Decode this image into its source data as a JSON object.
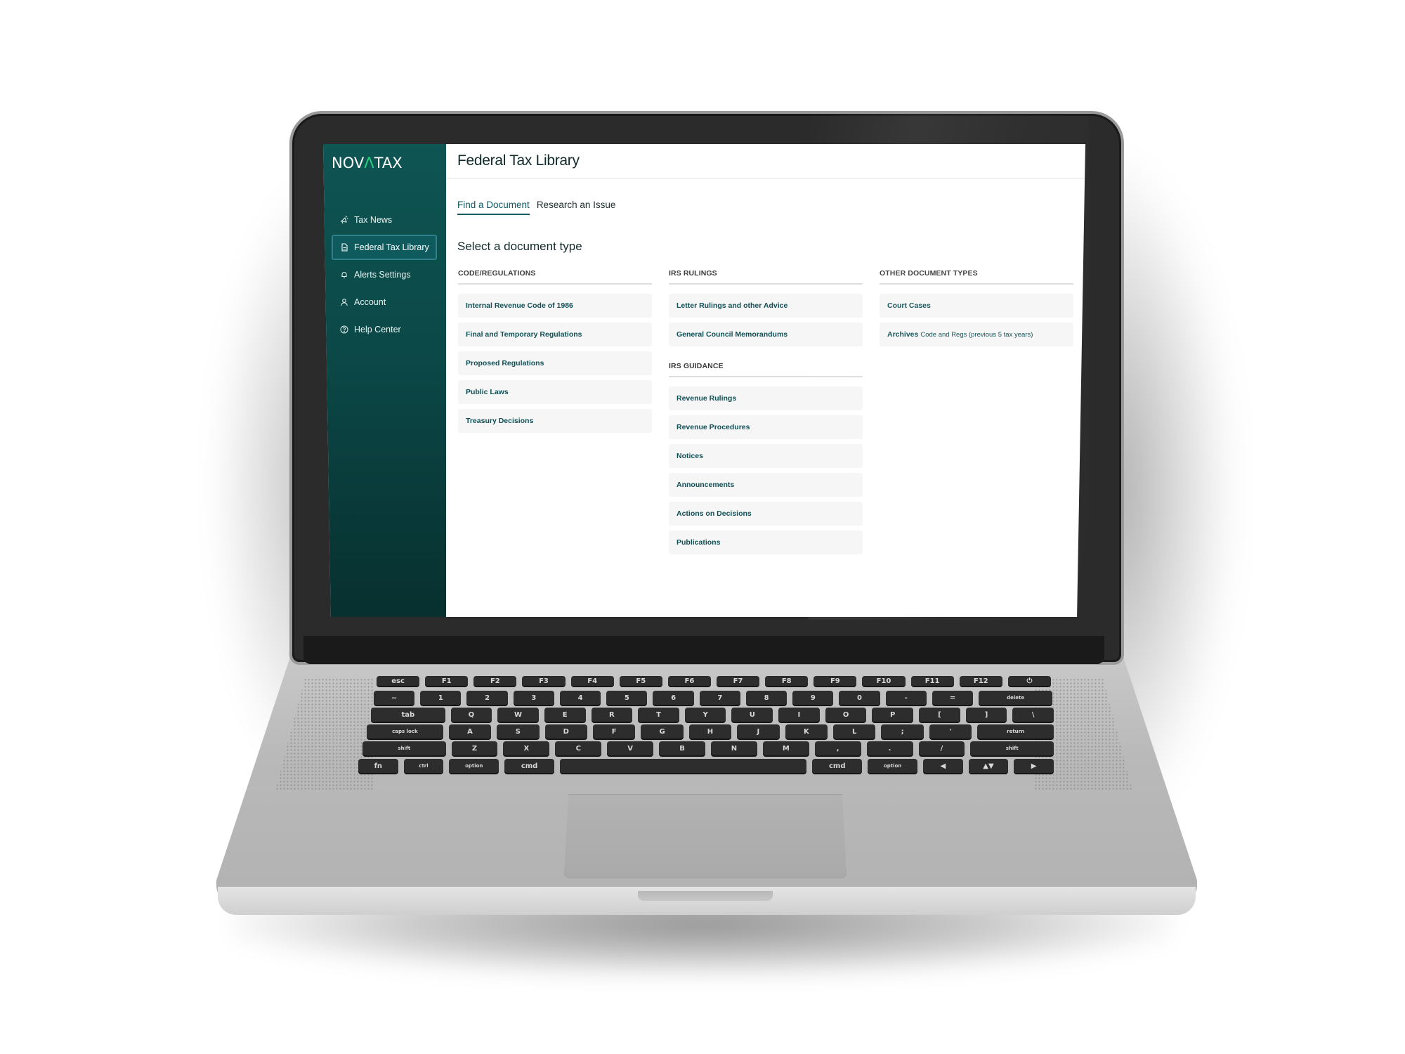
{
  "brand": {
    "logo_prefix": "NOV",
    "logo_accent": "Λ",
    "logo_suffix": "TAX",
    "accent_color": "#2ad17e",
    "primary_color": "#0f5a62"
  },
  "sidebar": {
    "items": [
      {
        "label": "Tax News",
        "icon": "megaphone-icon",
        "active": false
      },
      {
        "label": "Federal Tax Library",
        "icon": "document-icon",
        "active": true
      },
      {
        "label": "Alerts Settings",
        "icon": "bell-icon",
        "active": false
      },
      {
        "label": "Account",
        "icon": "user-icon",
        "active": false
      },
      {
        "label": "Help Center",
        "icon": "help-circle-icon",
        "active": false
      }
    ]
  },
  "header": {
    "title": "Federal Tax Library"
  },
  "tabs": [
    {
      "label": "Find a Document",
      "active": true
    },
    {
      "label": "Research an Issue",
      "active": false
    }
  ],
  "main": {
    "section_title": "Select a document type",
    "columns": [
      {
        "groups": [
          {
            "header": "CODE/REGULATIONS",
            "items": [
              {
                "label": "Internal Revenue Code of 1986"
              },
              {
                "label": "Final and Temporary Regulations"
              },
              {
                "label": "Proposed Regulations"
              },
              {
                "label": "Public Laws"
              },
              {
                "label": "Treasury Decisions"
              }
            ]
          }
        ]
      },
      {
        "groups": [
          {
            "header": "IRS RULINGS",
            "items": [
              {
                "label": "Letter Rulings and other Advice"
              },
              {
                "label": "General Council Memorandums"
              }
            ]
          },
          {
            "header": "IRS GUIDANCE",
            "items": [
              {
                "label": "Revenue Rulings"
              },
              {
                "label": "Revenue Procedures"
              },
              {
                "label": "Notices"
              },
              {
                "label": "Announcements"
              },
              {
                "label": "Actions on Decisions"
              },
              {
                "label": "Publications"
              }
            ]
          }
        ]
      },
      {
        "groups": [
          {
            "header": "OTHER DOCUMENT TYPES",
            "items": [
              {
                "label": "Court Cases"
              },
              {
                "label": "Archives",
                "sublabel": "Code and Regs (previous 5 tax years)"
              }
            ]
          }
        ]
      }
    ]
  },
  "keyboard": {
    "rows": [
      [
        "esc",
        "F1",
        "F2",
        "F3",
        "F4",
        "F5",
        "F6",
        "F7",
        "F8",
        "F9",
        "F10",
        "F11",
        "F12",
        "⏻"
      ],
      [
        "~",
        "1",
        "2",
        "3",
        "4",
        "5",
        "6",
        "7",
        "8",
        "9",
        "0",
        "-",
        "=",
        "delete"
      ],
      [
        "tab",
        "Q",
        "W",
        "E",
        "R",
        "T",
        "Y",
        "U",
        "I",
        "O",
        "P",
        "[",
        "]",
        "\\"
      ],
      [
        "caps lock",
        "A",
        "S",
        "D",
        "F",
        "G",
        "H",
        "J",
        "K",
        "L",
        ";",
        "'",
        "return"
      ],
      [
        "shift",
        "Z",
        "X",
        "C",
        "V",
        "B",
        "N",
        "M",
        ",",
        ".",
        "/",
        "shift"
      ],
      [
        "fn",
        "ctrl",
        "option",
        "cmd",
        "",
        "cmd",
        "option",
        "◀",
        "▲▼",
        "▶"
      ]
    ]
  }
}
